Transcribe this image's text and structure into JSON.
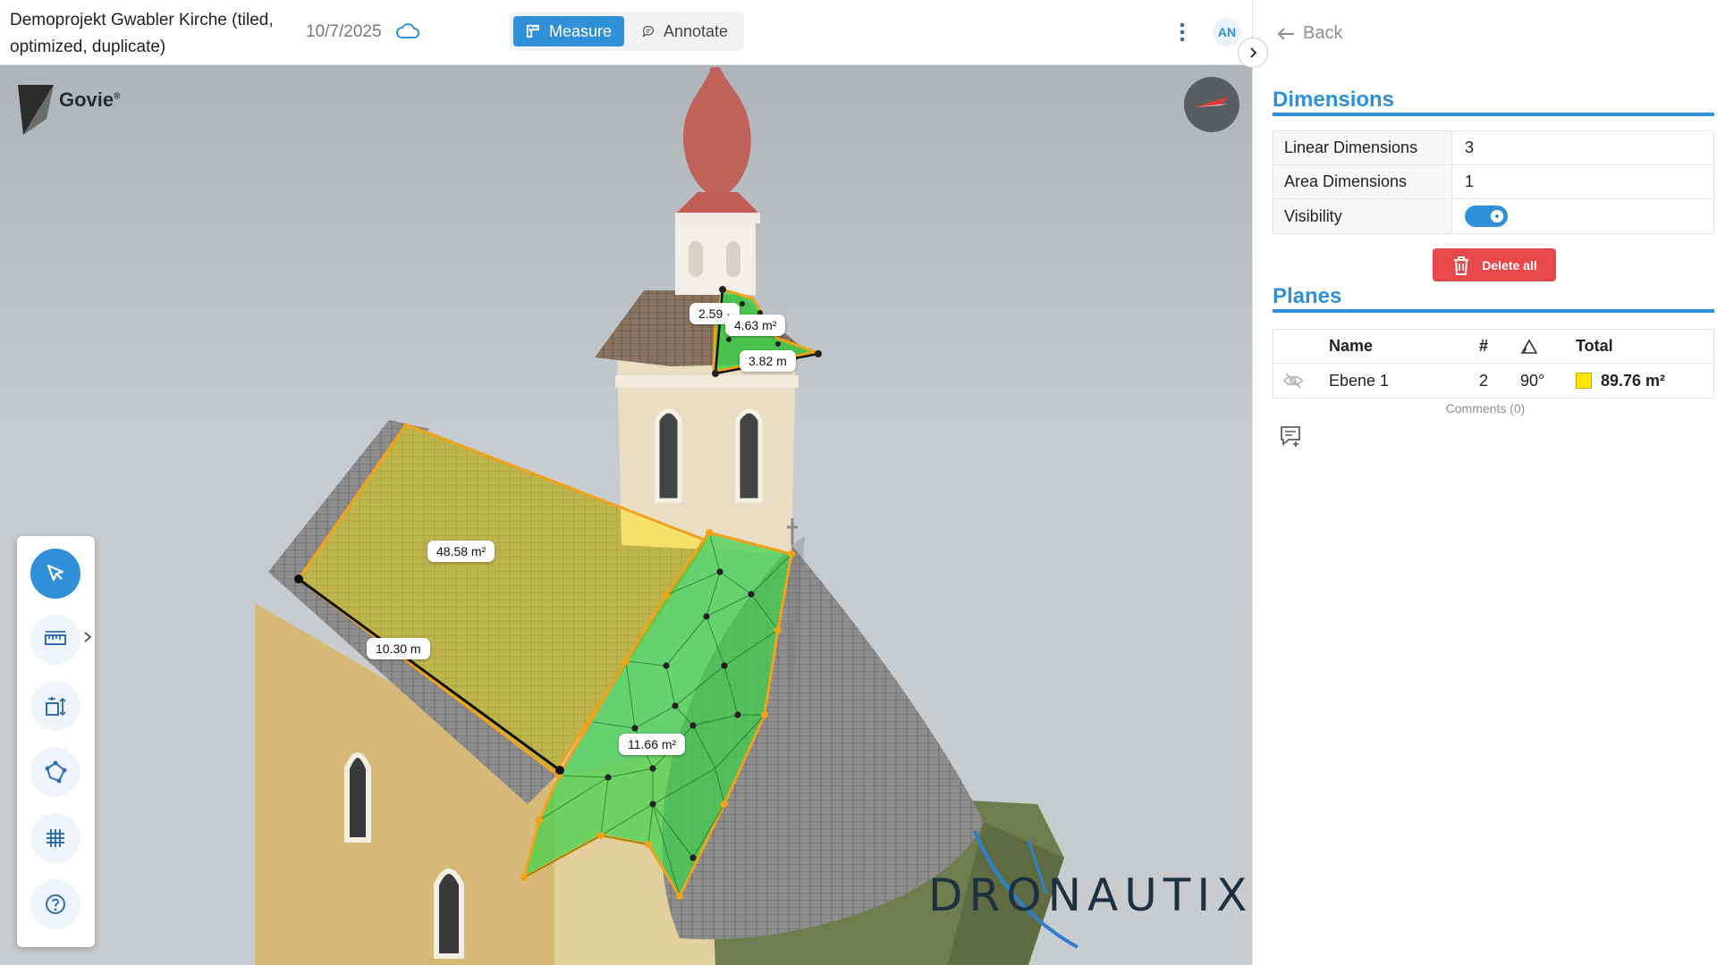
{
  "header": {
    "project_title": "Demoprojekt Gwabler Kirche (tiled, optimized, duplicate)",
    "date": "10/7/2025",
    "modes": {
      "measure": "Measure",
      "annotate": "Annotate"
    },
    "active_mode": "measure",
    "user_initials": "AN"
  },
  "viewport": {
    "logo_name": "Govie",
    "logo_mark": "®",
    "watermark": "DRONAUTIX",
    "labels": {
      "roof_area": "48.58 m²",
      "eave_length": "10.30 m",
      "valley_area": "11.66 m²",
      "tower_length_a": "2.59 ·",
      "tower_area": "4.63 m²",
      "tower_length_b": "3.82 m"
    }
  },
  "tools": {
    "items": [
      "select-tool",
      "measure-tool",
      "dimension-tool",
      "polygon-tool",
      "grid-tool",
      "help-tool"
    ],
    "active": "select-tool"
  },
  "panel": {
    "back_label": "Back",
    "dimensions_title": "Dimensions",
    "dimensions": [
      {
        "key": "Linear Dimensions",
        "value": "3"
      },
      {
        "key": "Area Dimensions",
        "value": "1"
      }
    ],
    "visibility_label": "Visibility",
    "visibility_on": true,
    "delete_all_label": "Delete all",
    "planes_title": "Planes",
    "planes_headers": {
      "name": "Name",
      "count": "#",
      "total": "Total"
    },
    "planes": [
      {
        "name": "Ebene 1",
        "count": "2",
        "angle": "90°",
        "total": "89.76 m²",
        "color": "#ffe600"
      }
    ],
    "comments_label": "Comments (0)"
  },
  "colors": {
    "accent": "#2f8fd8",
    "danger": "#e8484a",
    "highlight_yellow": "#ffe600",
    "highlight_green": "#3fd24a",
    "edge_orange": "#f2a21a"
  }
}
